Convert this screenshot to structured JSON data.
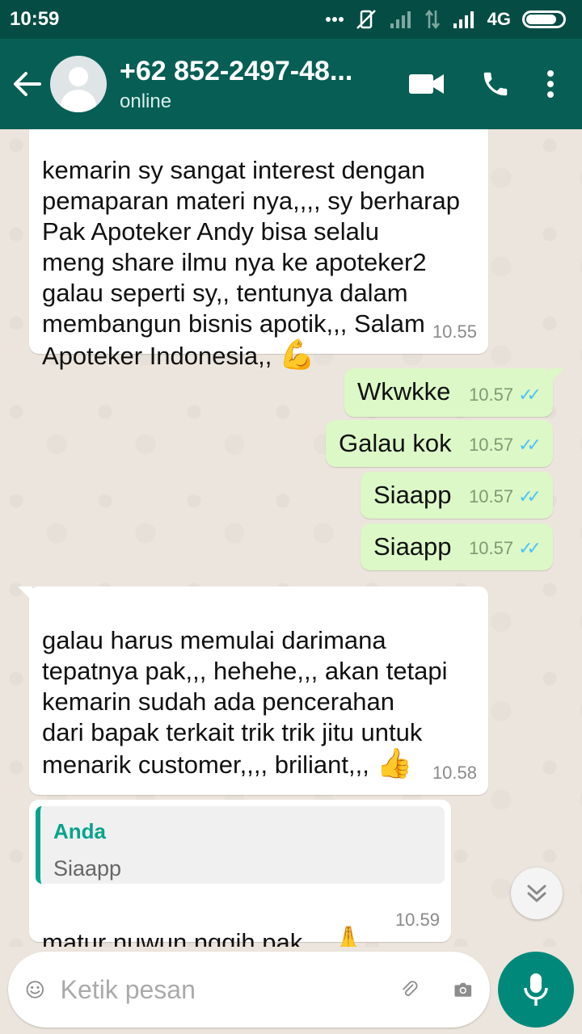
{
  "status_bar": {
    "time": "10:59",
    "network": "4G",
    "battery_level": 0.85
  },
  "header": {
    "contact_name": "+62 852-2497-48...",
    "contact_status": "online"
  },
  "messages": [
    {
      "direction": "incoming",
      "text": "kemarin sy sangat interest dengan\npemaparan materi nya,,,, sy berharap\nPak Apoteker Andy bisa selalu\nmeng share ilmu nya ke apoteker2\ngalau seperti sy,, tentunya dalam\nmembangun bisnis apotik,,, Salam\nApoteker Indonesia,,",
      "emoji": "💪",
      "time": "10.55"
    },
    {
      "direction": "outgoing",
      "text": "Wkwkke",
      "time": "10.57",
      "read": true
    },
    {
      "direction": "outgoing",
      "text": "Galau kok",
      "time": "10.57",
      "read": true
    },
    {
      "direction": "outgoing",
      "text": "Siaapp",
      "time": "10.57",
      "read": true
    },
    {
      "direction": "outgoing",
      "text": "Siaapp",
      "time": "10.57",
      "read": true
    },
    {
      "direction": "incoming",
      "text": "galau harus memulai darimana\ntepatnya pak,,, hehehe,,, akan tetapi\nkemarin sudah ada pencerahan\ndari bapak terkait trik trik jitu untuk\nmenarik customer,,,, briliant,,,",
      "emoji": "👍",
      "time": "10.58"
    },
    {
      "direction": "incoming",
      "quote": {
        "author": "Anda",
        "text": "Siaapp"
      },
      "text": "matur nuwun nggih pak,,,",
      "emoji": "🙏",
      "time": "10.59"
    }
  ],
  "composer": {
    "placeholder": "Ketik pesan"
  },
  "colors": {
    "header": "#075e54",
    "status_bar": "#054d44",
    "outgoing_bubble": "#dcf8c6",
    "incoming_bubble": "#ffffff",
    "accent": "#06a38c",
    "read_ticks": "#4fc3f7",
    "mic_button": "#00897b"
  },
  "icons": {
    "back": "arrow-left-icon",
    "video": "video-camera-icon",
    "call": "phone-icon",
    "menu": "more-vert-icon",
    "emoji": "smiley-icon",
    "attach": "paperclip-icon",
    "camera": "camera-icon",
    "mic": "microphone-icon",
    "scroll": "double-chevron-down-icon"
  }
}
